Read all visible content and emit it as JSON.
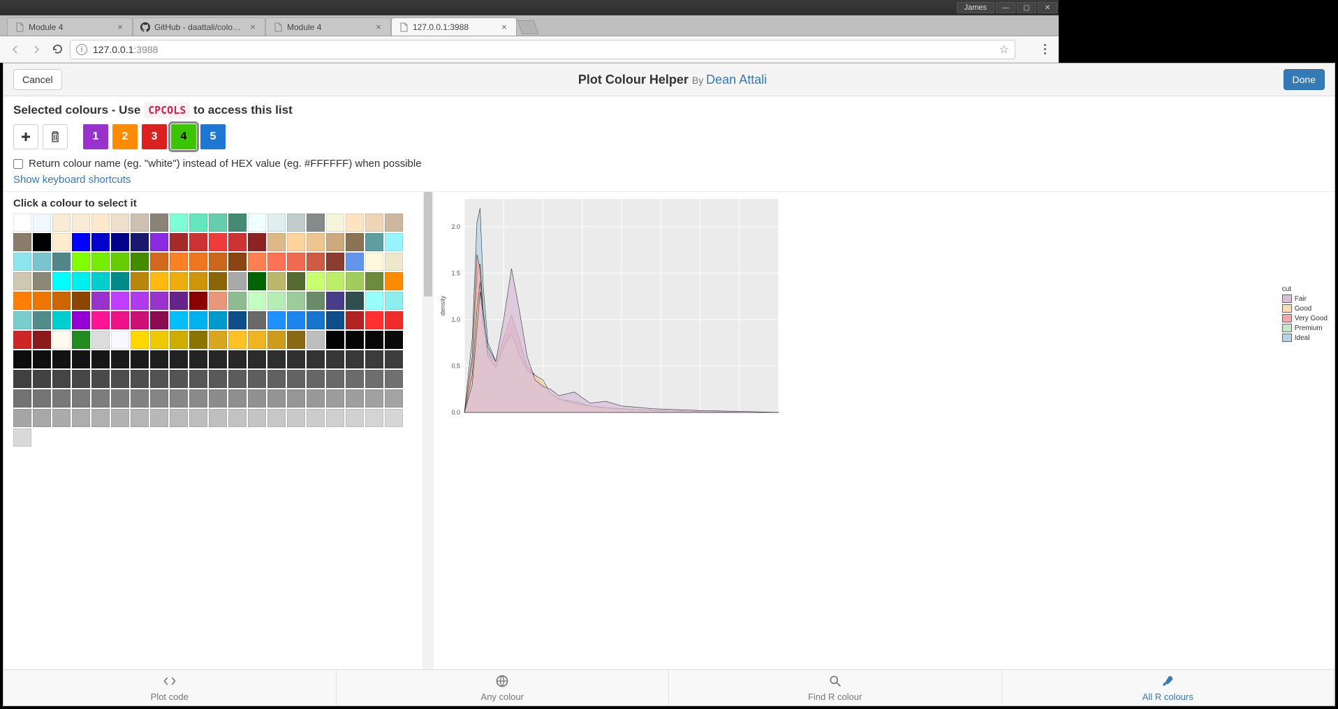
{
  "window": {
    "user": "James"
  },
  "browser": {
    "tabs": [
      {
        "label": "Module 4",
        "active": false,
        "favicon": "page"
      },
      {
        "label": "GitHub - daattali/colour…",
        "active": false,
        "favicon": "github"
      },
      {
        "label": "Module 4",
        "active": false,
        "favicon": "page"
      },
      {
        "label": "127.0.0.1:3988",
        "active": true,
        "favicon": "page"
      }
    ],
    "url_host": "127.0.0.1",
    "url_port": ":3988"
  },
  "header": {
    "cancel": "Cancel",
    "title": "Plot Colour Helper",
    "by": "By ",
    "author": "Dean Attali",
    "done": "Done"
  },
  "selected": {
    "label_prefix": "Selected colours - Use ",
    "code": "CPCOLS",
    "label_suffix": " to access this list",
    "swatches": [
      {
        "n": "1",
        "color": "#9932CC"
      },
      {
        "n": "2",
        "color": "#FF8C00"
      },
      {
        "n": "3",
        "color": "#D92121"
      },
      {
        "n": "4",
        "color": "#3DC400",
        "selected": true,
        "textdark": true
      },
      {
        "n": "5",
        "color": "#1F77D4"
      }
    ],
    "checkbox_label": "Return colour name (eg. \"white\") instead of HEX value (eg. #FFFFFF) when possible",
    "shortcuts": "Show keyboard shortcuts"
  },
  "palette": {
    "title": "Click a colour to select it",
    "rows": [
      [
        "#FFFFFF",
        "#F0F8FF",
        "#FAEBD7",
        "#FAEBD7",
        "#FFE9CC",
        "#EEDFCC",
        "#CDC0B0",
        "#8B8378",
        "#7FFFD4",
        "#66E6BE",
        "#66CDAA",
        "#458B74",
        "#F0FFFF",
        "#E0EEEE",
        "#C1CDCD",
        "#838B8B",
        "#F5F5DC",
        "#FFE4C4",
        "#EED5B7",
        "#CDB79E",
        "#8B7D6B"
      ],
      [
        "#000000",
        "#FFEBCD",
        "#0000FF",
        "#0000CD",
        "#00008B",
        "#191970",
        "#8A2BE2",
        "#A52A2A",
        "#CD3333",
        "#EE3B3B",
        "#CD3333",
        "#8B2323",
        "#DEB887",
        "#FFD39B",
        "#EEC591",
        "#CDAA7D",
        "#8B7355",
        "#5F9EA0",
        "#98F5FF",
        "#8EE5EE"
      ],
      [
        "#7AC5CD",
        "#53868B",
        "#7FFF00",
        "#76EE00",
        "#66CD00",
        "#458B00",
        "#D2691E",
        "#FF7F24",
        "#EE7621",
        "#CD661D",
        "#8B4513",
        "#FF7F50",
        "#FF7256",
        "#EE6A50",
        "#CD5B45",
        "#8B3E2F",
        "#6495ED",
        "#FFF8DC",
        "#EEE8CD",
        "#CDC8B1"
      ],
      [
        "#8B8878",
        "#00FFFF",
        "#00EEEE",
        "#00CDCD",
        "#008B8B",
        "#B8860B",
        "#FFB90F",
        "#EEAD0E",
        "#CD950C",
        "#8B6508",
        "#A9A9A9",
        "#006400",
        "#BDB76B",
        "#556B2F",
        "#CAFF70",
        "#BCEE68",
        "#A2CD5A",
        "#6E8B3D",
        "#FF8C00",
        "#FF7F00"
      ],
      [
        "#EE7600",
        "#CD6600",
        "#8B4500",
        "#9932CC",
        "#BF3EFF",
        "#B23AEE",
        "#9A32CD",
        "#68228B",
        "#8B0000",
        "#E9967A",
        "#8FBC8F",
        "#C1FFC1",
        "#B4EEB4",
        "#9BCD9B",
        "#698B69",
        "#483D8B",
        "#2F4F4F",
        "#97FFFF",
        "#8DEEEE",
        "#79CDCD"
      ],
      [
        "#528B8B",
        "#00CED1",
        "#9400D3",
        "#FF1493",
        "#EE1289",
        "#CD1076",
        "#8B0A50",
        "#00BFFF",
        "#00B2EE",
        "#009ACD",
        "#104E8B",
        "#696969",
        "#1E90FF",
        "#1C86EE",
        "#1874CD",
        "#104E8B",
        "#B22222",
        "#FF3030",
        "#EE2C2C",
        "#CD2626"
      ],
      [
        "#8B1A1A",
        "#FFFAF0",
        "#228B22",
        "#DCDCDC",
        "#F8F8FF",
        "#FFD700",
        "#EEC900",
        "#CDAD00",
        "#8B7500",
        "#DAA520",
        "#FFC125",
        "#EEB422",
        "#CD9B1D",
        "#8B6914",
        "#BEBEBE",
        "#030303",
        "#050505",
        "#080808",
        "#0A0A0A",
        "#0D0D0D"
      ],
      [
        "#0F0F0F",
        "#121212",
        "#141414",
        "#171717",
        "#1A1A1A",
        "#1C1C1C",
        "#1F1F1F",
        "#212121",
        "#242424",
        "#262626",
        "#292929",
        "#2B2B2B",
        "#2E2E2E",
        "#303030",
        "#333333",
        "#363636",
        "#383838",
        "#3B3B3B",
        "#3D3D3D",
        "#404040"
      ],
      [
        "#424242",
        "#454545",
        "#474747",
        "#4A4A4A",
        "#4D4D4D",
        "#4F4F4F",
        "#525252",
        "#545454",
        "#575757",
        "#595959",
        "#5C5C5C",
        "#5E5E5E",
        "#616161",
        "#636363",
        "#666666",
        "#696969",
        "#6B6B6B",
        "#6E6E6E",
        "#707070",
        "#737373"
      ],
      [
        "#757575",
        "#787878",
        "#7A7A7A",
        "#7D7D7D",
        "#7F7F7F",
        "#828282",
        "#858585",
        "#878787",
        "#8A8A8A",
        "#8C8C8C",
        "#8F8F8F",
        "#919191",
        "#949494",
        "#969696",
        "#999999",
        "#9C9C9C",
        "#9E9E9E",
        "#A1A1A1",
        "#A3A3A3",
        "#A6A6A6"
      ],
      [
        "#A8A8A8",
        "#ABABAB",
        "#ADADAD",
        "#B0B0B0",
        "#B3B3B3",
        "#B5B5B5",
        "#B8B8B8",
        "#BABABA",
        "#BDBDBD",
        "#BFBFBF",
        "#C2C2C2",
        "#C4C4C4",
        "#C7C7C7",
        "#C9C9C9",
        "#CCCCCC",
        "#CFCFCF",
        "#D1D1D1",
        "#D4D4D4",
        "#D6D6D6",
        "#D9D9D9"
      ]
    ]
  },
  "bottomtabs": [
    {
      "icon": "code",
      "label": "Plot code"
    },
    {
      "icon": "globe",
      "label": "Any colour"
    },
    {
      "icon": "search",
      "label": "Find R colour"
    },
    {
      "icon": "brush",
      "label": "All R colours",
      "active": true
    }
  ],
  "chart_data": {
    "type": "area",
    "xlabel": "",
    "ylabel": "density",
    "legend_title": "cut",
    "xlim": [
      0,
      20000
    ],
    "ylim": [
      0,
      2.3
    ],
    "y_ticks": [
      0.0,
      0.5,
      1.0,
      1.5,
      2.0
    ],
    "x": [
      0,
      500,
      800,
      1000,
      1200,
      1500,
      2000,
      2500,
      3000,
      3500,
      4000,
      4500,
      5000,
      5500,
      6000,
      7000,
      8000,
      9000,
      10000,
      12000,
      15000,
      18000,
      20000
    ],
    "series": [
      {
        "name": "Fair",
        "color": "#D8BFD8",
        "values": [
          0,
          0.3,
          0.9,
          1.3,
          1.05,
          0.7,
          0.55,
          1.0,
          1.55,
          1.1,
          0.6,
          0.35,
          0.28,
          0.25,
          0.18,
          0.22,
          0.1,
          0.12,
          0.07,
          0.04,
          0.02,
          0.01,
          0.0
        ]
      },
      {
        "name": "Good",
        "color": "#F5DEB3",
        "values": [
          0,
          0.4,
          1.1,
          1.4,
          0.95,
          0.6,
          0.48,
          0.7,
          0.85,
          0.62,
          0.45,
          0.4,
          0.35,
          0.2,
          0.15,
          0.1,
          0.07,
          0.05,
          0.04,
          0.02,
          0.01,
          0.0,
          0.0
        ]
      },
      {
        "name": "Very Good",
        "color": "#F4A7A7",
        "values": [
          0,
          0.6,
          1.7,
          1.55,
          1.0,
          0.62,
          0.55,
          0.8,
          1.05,
          0.78,
          0.5,
          0.4,
          0.3,
          0.18,
          0.13,
          0.1,
          0.06,
          0.05,
          0.03,
          0.02,
          0.01,
          0.0,
          0.0
        ]
      },
      {
        "name": "Premium",
        "color": "#C8E6C9",
        "values": [
          0,
          0.55,
          1.45,
          1.6,
          1.1,
          0.65,
          0.52,
          0.72,
          0.92,
          0.7,
          0.48,
          0.35,
          0.28,
          0.2,
          0.14,
          0.12,
          0.07,
          0.05,
          0.04,
          0.02,
          0.01,
          0.0,
          0.0
        ]
      },
      {
        "name": "Ideal",
        "color": "#B6D4E9",
        "values": [
          0,
          0.8,
          2.05,
          2.2,
          1.35,
          0.75,
          0.55,
          0.68,
          0.78,
          0.58,
          0.4,
          0.3,
          0.22,
          0.15,
          0.1,
          0.08,
          0.05,
          0.04,
          0.03,
          0.02,
          0.01,
          0.0,
          0.0
        ]
      }
    ]
  }
}
